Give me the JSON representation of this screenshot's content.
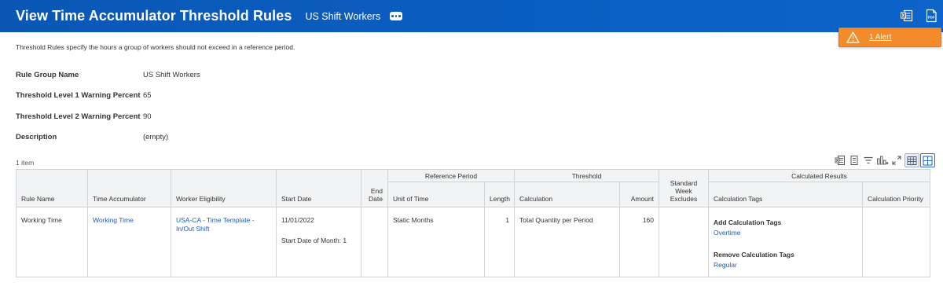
{
  "header": {
    "title": "View Time Accumulator Threshold Rules",
    "subtitle": "US Shift Workers"
  },
  "alert": {
    "label": "1 Alert"
  },
  "intro": "Threshold Rules specify the hours a group of workers should not exceed in a reference period.",
  "fields": [
    {
      "label": "Rule Group Name",
      "value": "US Shift Workers"
    },
    {
      "label": "Threshold Level 1 Warning Percent",
      "value": "65"
    },
    {
      "label": "Threshold Level 2 Warning Percent",
      "value": "90"
    },
    {
      "label": "Description",
      "value": "(empty)"
    }
  ],
  "table": {
    "count": "1 item",
    "groups": {
      "reference_period": "Reference Period",
      "threshold": "Threshold",
      "calculated_results": "Calculated Results"
    },
    "columns": {
      "rule_name": "Rule Name",
      "time_accumulator": "Time Accumulator",
      "worker_eligibility": "Worker Eligibility",
      "start_date": "Start Date",
      "end_date": "End Date",
      "unit_of_time": "Unit of Time",
      "length": "Length",
      "calculation": "Calculation",
      "amount": "Amount",
      "standard_week_excludes": "Standard Week Excludes",
      "calculation_tags": "Calculation Tags",
      "calculation_priority": "Calculation Priority"
    },
    "rows": [
      {
        "rule_name": "Working Time",
        "time_accumulator": "Working Time",
        "worker_eligibility": "USA-CA - Time Template - In/Out Shift",
        "start_date": "11/01/2022",
        "start_date_note": "Start Date of Month: 1",
        "end_date": "",
        "unit_of_time": "Static Months",
        "length": "1",
        "calculation": "Total Quantity per Period",
        "amount": "160",
        "standard_week_excludes": "",
        "add_tags_label": "Add Calculation Tags",
        "add_tags_value": "Overtime",
        "remove_tags_label": "Remove Calculation Tags",
        "remove_tags_value": "Regular",
        "calculation_priority": ""
      }
    ]
  },
  "colors": {
    "header_bg": "#0b5fc2",
    "alert_bg": "#f38b2a",
    "link": "#1a5cbf",
    "table_header_bg": "#f2f3f4"
  },
  "icons": {
    "header": [
      "more-actions-icon",
      "excel-export-icon",
      "pdf-export-icon"
    ],
    "alert": "warning-icon",
    "toolbar": [
      "excel-export-icon",
      "print-icon",
      "filter-icon",
      "chart-icon",
      "fullscreen-icon",
      "table-view-icon",
      "grid-view-icon"
    ]
  }
}
